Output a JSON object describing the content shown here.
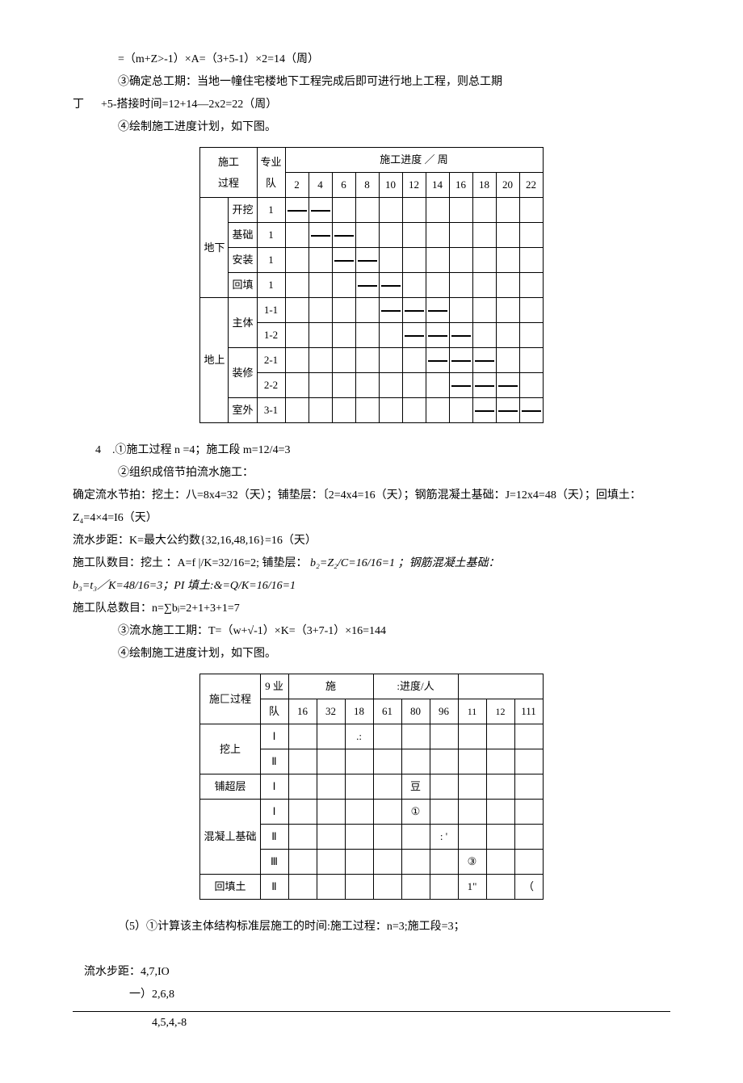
{
  "p1": "=（m+Z>-1）×A=（3+5-1）×2=14（周）",
  "p2": "③确定总工期：当地一幢住宅楼地下工程完成后即可进行地上工程，则总工期",
  "p3_left": "丁",
  "p3_right": "+5-搭接时间=12+14—2x2=22（周）",
  "p4": "④绘制施工进度计划，如下图。",
  "t1": {
    "h1": "施工",
    "h2": "过程",
    "h3": "专业",
    "h4": "队",
    "h5": "施工进度 ／ 周",
    "cols": [
      "2",
      "4",
      "6",
      "8",
      "10",
      "12",
      "14",
      "16",
      "18",
      "20",
      "22"
    ],
    "g1": "地下",
    "r1": {
      "name": "开挖",
      "team": "1"
    },
    "r2": {
      "name": "基础",
      "team": "1"
    },
    "r3": {
      "name": "安装",
      "team": "1"
    },
    "r4": {
      "name": "回填",
      "team": "1"
    },
    "g2": "地上",
    "r5": {
      "name": "主体",
      "team1": "1-1",
      "team2": "1-2"
    },
    "r6": {
      "name": "装修",
      "team1": "2-1",
      "team2": "2-2"
    },
    "r7": {
      "name": "室外",
      "team": "3-1"
    }
  },
  "p5": "4　.①施工过程 n =4；施工段 m=12/4=3",
  "p6": "②组织成倍节拍流水施工：",
  "p7": "确定流水节拍：挖土：八=8x4=32（天）；铺垫层：〔2=4x4=16（天）；钢筋混凝土基础：J=12x4=48（天）；回填土：Z₄=4×4=I6（天）",
  "p8": "流水步距：K=最大公约数{32,16,48,16}=16（天）",
  "p9_a": "施工队数目：挖土 ：A=f |/K=32/16=2; 铺垫层：",
  "p9_b": "b₂=Z₂/C=16/16=1 ；钢筋混凝土基础：",
  "p10_a": "b₃=t₃／K=48/16=3；PI 填土:&=Q/K=16/16=1",
  "p11": "施工队总数目：n=∑bⱼ=2+1+3+1=7",
  "p12": "③流水施工工期：T=（w+√-1）×K=（3+7-1）×16=144",
  "p13": "④绘制施工进度计划，如下图。",
  "t2": {
    "h1": "施匚过程",
    "h2a": "9 业",
    "h2b": "队",
    "h3a": "施",
    "h3b": ":进度/人",
    "cols": [
      "16",
      "32",
      "18",
      "61",
      "80",
      "96",
      "11",
      "12",
      "111"
    ],
    "r1": {
      "name": "挖上",
      "team1": "Ⅰ",
      "team2": "Ⅱ",
      "m1": ".:"
    },
    "r2": {
      "name": "铺超层",
      "team": "Ⅰ",
      "m": "豆"
    },
    "r3": {
      "name": "混凝丄基础",
      "team1": "Ⅰ",
      "team2": "Ⅱ",
      "team3": "Ⅲ",
      "m1": "①",
      "m2": ": '",
      "m3": "③"
    },
    "r4": {
      "name": "回填土",
      "team": "Ⅱ",
      "m1": "1\"",
      "m2": "（"
    }
  },
  "p14": "（5）①计算该主体结构标准层施工的时间:施工过程：n=3;施工段=3；",
  "p15": "流水步距：4,7,IO",
  "p16": "一）2,6,8",
  "p17": "4,5,4,-8"
}
